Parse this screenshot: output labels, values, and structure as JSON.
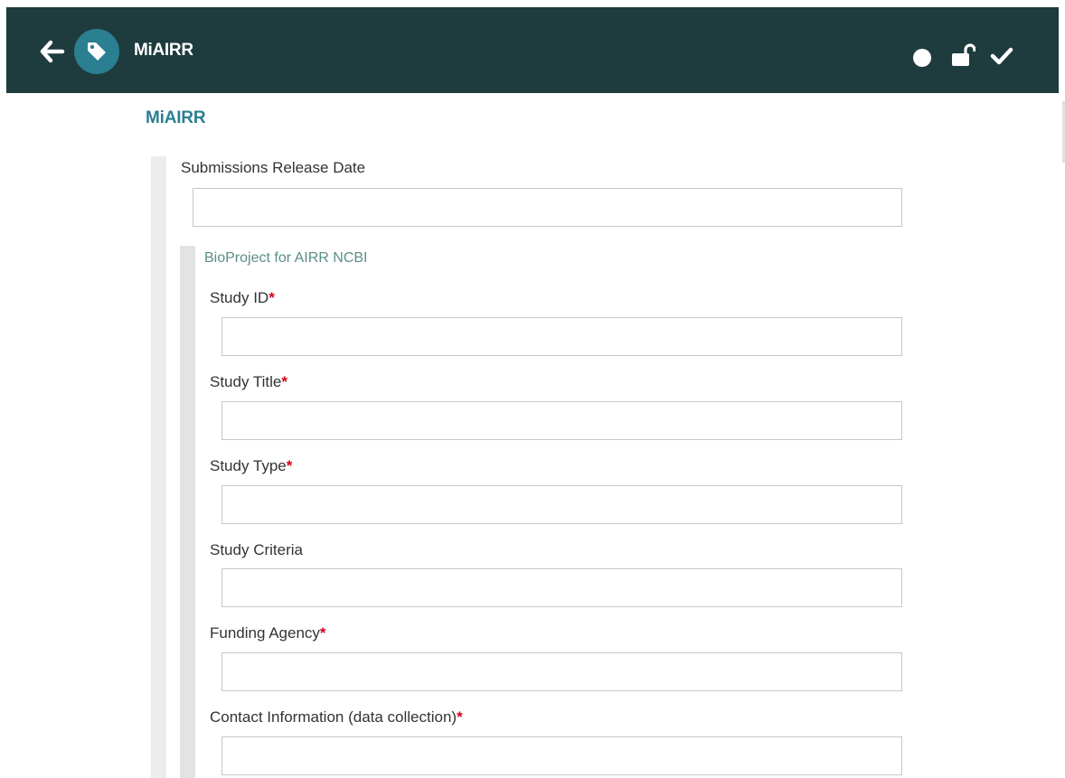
{
  "header": {
    "title": "MiAIRR",
    "back_icon": "arrow-left-icon",
    "tag_icon": "tag-icon",
    "status_icon": "circle-icon",
    "lock_icon": "unlock-icon",
    "check_icon": "checkmark-icon",
    "colors": {
      "bar": "#1e3b3e",
      "accent": "#2a7f91"
    }
  },
  "form": {
    "section_title": "MiAIRR",
    "release_date": {
      "label": "Submissions Release Date",
      "value": "",
      "placeholder": ""
    },
    "subsection_title": "BioProject for AIRR NCBI",
    "required_marker": "*",
    "fields": [
      {
        "label": "Study ID",
        "required": true,
        "value": ""
      },
      {
        "label": "Study Title",
        "required": true,
        "value": ""
      },
      {
        "label": "Study Type",
        "required": true,
        "value": ""
      },
      {
        "label": "Study Criteria",
        "required": false,
        "value": ""
      },
      {
        "label": "Funding Agency",
        "required": true,
        "value": ""
      },
      {
        "label": "Contact Information (data collection)",
        "required": true,
        "value": ""
      }
    ]
  }
}
